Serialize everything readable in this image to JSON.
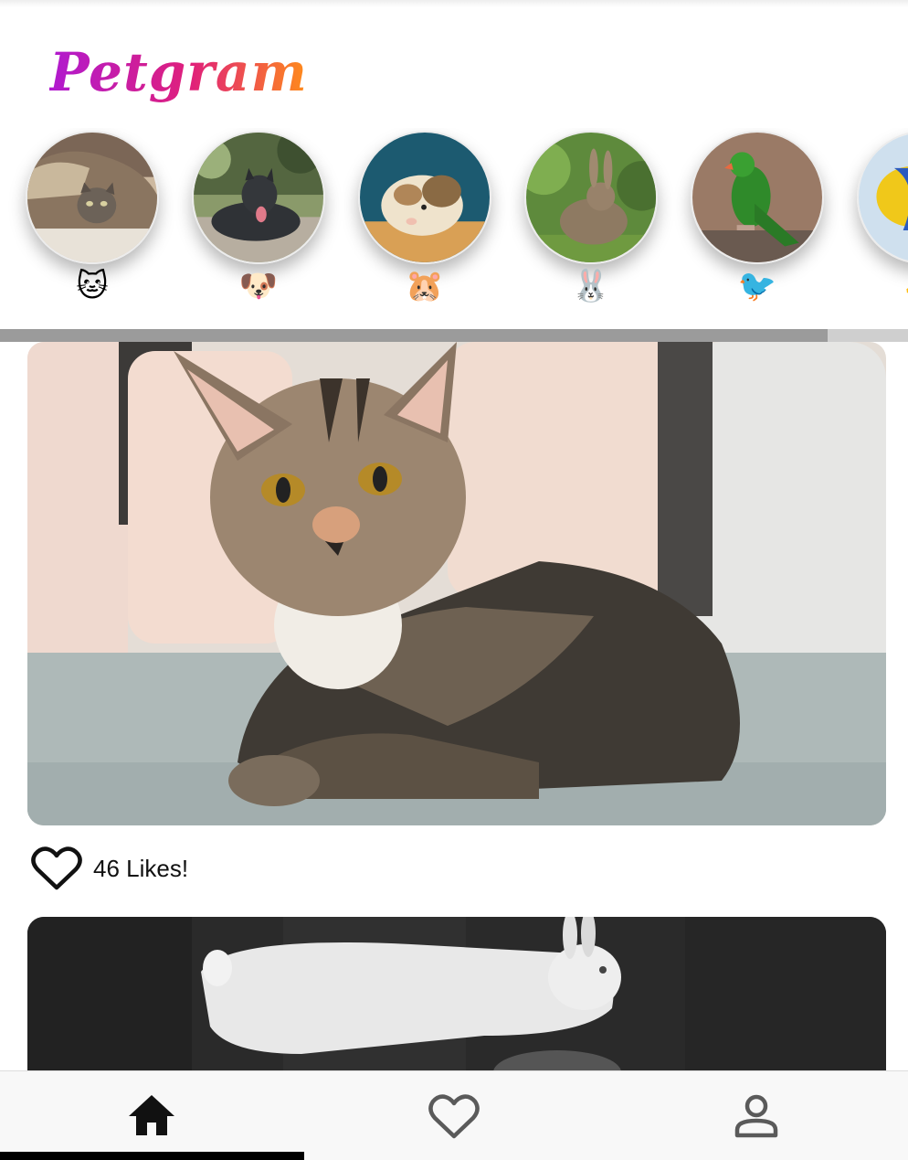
{
  "app": {
    "title": "Petgram"
  },
  "stories": [
    {
      "id": "cat",
      "emoji": "🐱",
      "icon": "cat-face-icon"
    },
    {
      "id": "dog",
      "emoji": "🐶",
      "icon": "dog-face-icon"
    },
    {
      "id": "hamster",
      "emoji": "🐹",
      "icon": "hamster-face-icon"
    },
    {
      "id": "rabbit",
      "emoji": "🐰",
      "icon": "rabbit-face-icon"
    },
    {
      "id": "bird",
      "emoji": "🐦",
      "icon": "bird-icon"
    },
    {
      "id": "fish",
      "emoji": "🐠",
      "icon": "fish-icon"
    }
  ],
  "feed": {
    "posts": [
      {
        "animal": "cat",
        "likes_label": "46 Likes!",
        "liked": false
      },
      {
        "animal": "rabbit",
        "likes_label": "",
        "liked": false
      }
    ]
  },
  "bottom_nav": {
    "items": [
      {
        "id": "home",
        "icon": "home-icon",
        "active": true
      },
      {
        "id": "favorites",
        "icon": "heart-outline-icon",
        "active": false
      },
      {
        "id": "profile",
        "icon": "user-icon",
        "active": false
      }
    ]
  },
  "colors": {
    "logo_gradient": [
      "#b01ad0",
      "#e0207a",
      "#ff8c1a"
    ],
    "nav_background": "#f8f8f8",
    "active_icon": "#111111",
    "inactive_icon": "#5a5a5a"
  }
}
